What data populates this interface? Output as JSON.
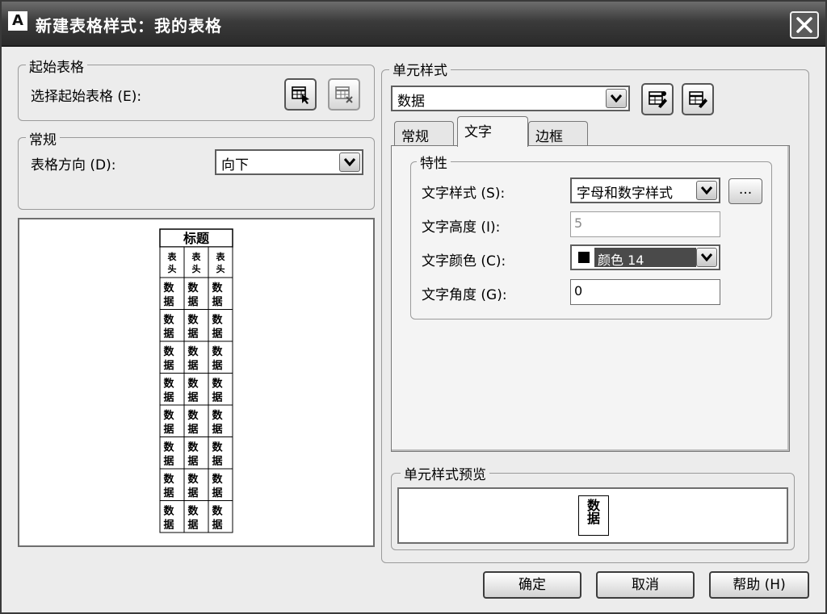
{
  "window": {
    "title": "新建表格样式：我的表格",
    "app_icon": "A"
  },
  "start_table": {
    "legend": "起始表格",
    "select_label": "选择起始表格 (E):"
  },
  "general": {
    "legend": "常规",
    "direction_label": "表格方向 (D):",
    "direction_value": "向下"
  },
  "preview": {
    "title": "标题",
    "header_cells": [
      "表头",
      "表头",
      "表头"
    ],
    "data_cell": "数据",
    "data_rows": 8
  },
  "cell_style": {
    "legend": "单元样式",
    "selected": "数据",
    "tabs": [
      {
        "label": "常规",
        "active": false
      },
      {
        "label": "文字",
        "active": true
      },
      {
        "label": "边框",
        "active": false
      }
    ]
  },
  "properties": {
    "legend": "特性",
    "text_style_label": "文字样式 (S):",
    "text_style_value": "字母和数字样式",
    "text_style_browse": "...",
    "text_height_label": "文字高度 (I):",
    "text_height_value": "5",
    "text_color_label": "文字颜色 (C):",
    "text_color_value": "颜色 14",
    "text_color_swatch": "#000000",
    "text_angle_label": "文字角度 (G):",
    "text_angle_value": "0"
  },
  "cell_preview": {
    "legend": "单元样式预览",
    "cell_text": "数据"
  },
  "buttons": {
    "ok": "确定",
    "cancel": "取消",
    "help": "帮助 (H)"
  }
}
